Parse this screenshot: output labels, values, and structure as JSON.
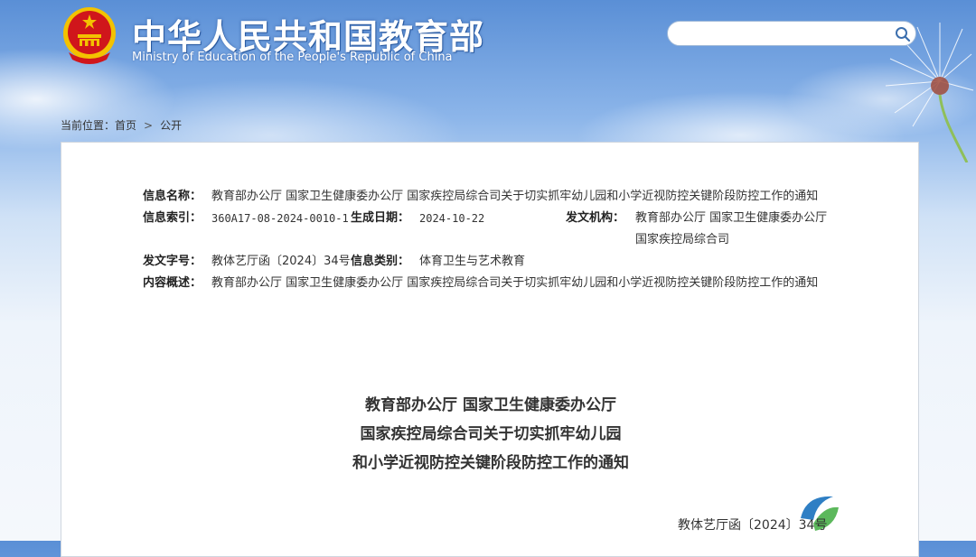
{
  "header": {
    "site_name_cn": "中华人民共和国教育部",
    "site_name_en": "Ministry of Education of the People's Republic of China",
    "search": {
      "placeholder": "",
      "value": ""
    }
  },
  "breadcrumb": {
    "prefix": "当前位置：",
    "items": [
      "首页",
      "公开"
    ],
    "separator": ">"
  },
  "info": {
    "name_label": "信息名称：",
    "name_value": "教育部办公厅 国家卫生健康委办公厅 国家疾控局综合司关于切实抓牢幼儿园和小学近视防控关键阶段防控工作的通知",
    "index_label": "信息索引：",
    "index_value": "360A17-08-2024-0010-1",
    "date_label": "生成日期：",
    "date_value": "2024-10-22",
    "issuer_label": "发文机构：",
    "issuer_line1": "教育部办公厅 国家卫生健康委办公厅",
    "issuer_line2": "国家疾控局综合司",
    "docno_label": "发文字号：",
    "docno_value": "教体艺厅函〔2024〕34号",
    "category_label": "信息类别：",
    "category_value": "体育卫生与艺术教育",
    "summary_label": "内容概述：",
    "summary_value": "教育部办公厅 国家卫生健康委办公厅 国家疾控局综合司关于切实抓牢幼儿园和小学近视防控关键阶段防控工作的通知"
  },
  "document": {
    "title_line1": "教育部办公厅 国家卫生健康委办公厅",
    "title_line2": "国家疾控局综合司关于切实抓牢幼儿园",
    "title_line3": "和小学近视防控关键阶段防控工作的通知",
    "doc_number": "教体艺厅函〔2024〕34号"
  },
  "colors": {
    "sky_top": "#5a8fd6",
    "emblem_red": "#d0161b",
    "emblem_gold": "#f3c200"
  }
}
